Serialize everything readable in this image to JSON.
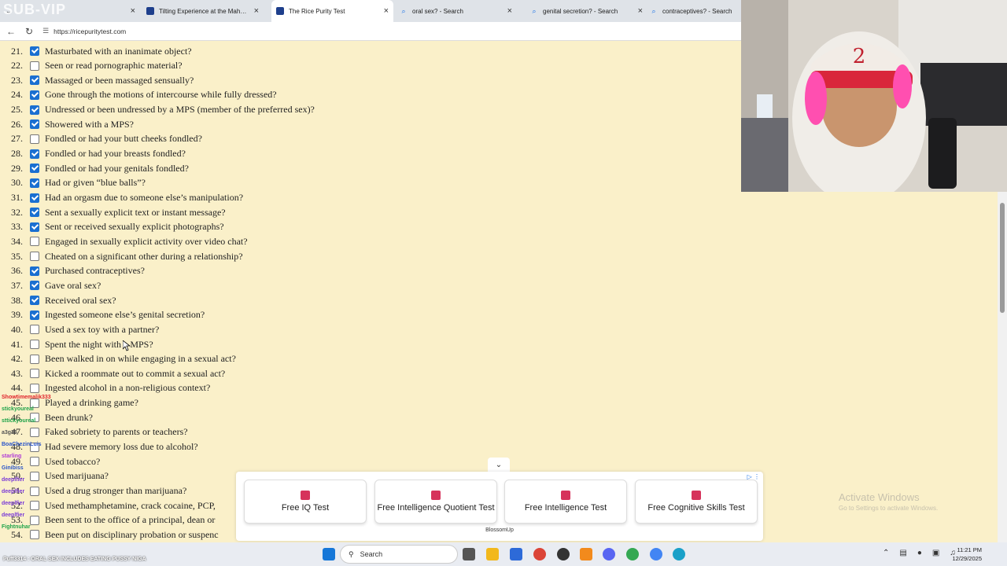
{
  "browser": {
    "tabs": [
      {
        "label": "",
        "icon": "ellipsis"
      },
      {
        "label": "Tilting Experience at the Mahankli",
        "icon": "blue-square"
      },
      {
        "label": "The Rice Purity Test",
        "icon": "blue-square",
        "active": true
      },
      {
        "label": "oral sex? - Search",
        "icon": "search"
      },
      {
        "label": "genital secretion? - Search",
        "icon": "search"
      },
      {
        "label": "contraceptives? - Search",
        "icon": "search"
      }
    ],
    "url": "https://ricepuritytest.com"
  },
  "stream_brand": "SUB-VIP",
  "questions": [
    {
      "num": "21.",
      "text": "Masturbated with an inanimate object?",
      "checked": true
    },
    {
      "num": "22.",
      "text": "Seen or read pornographic material?",
      "checked": false
    },
    {
      "num": "23.",
      "text": "Massaged or been massaged sensually?",
      "checked": true
    },
    {
      "num": "24.",
      "text": "Gone through the motions of intercourse while fully dressed?",
      "checked": true
    },
    {
      "num": "25.",
      "text": "Undressed or been undressed by a MPS (member of the preferred sex)?",
      "checked": true
    },
    {
      "num": "26.",
      "text": "Showered with a MPS?",
      "checked": true
    },
    {
      "num": "27.",
      "text": "Fondled or had your butt cheeks fondled?",
      "checked": false
    },
    {
      "num": "28.",
      "text": "Fondled or had your breasts fondled?",
      "checked": true
    },
    {
      "num": "29.",
      "text": "Fondled or had your genitals fondled?",
      "checked": true
    },
    {
      "num": "30.",
      "text": "Had or given “blue balls”?",
      "checked": true
    },
    {
      "num": "31.",
      "text": "Had an orgasm due to someone else’s manipulation?",
      "checked": true
    },
    {
      "num": "32.",
      "text": "Sent a sexually explicit text or instant message?",
      "checked": true
    },
    {
      "num": "33.",
      "text": "Sent or received sexually explicit photographs?",
      "checked": true
    },
    {
      "num": "34.",
      "text": "Engaged in sexually explicit activity over video chat?",
      "checked": false
    },
    {
      "num": "35.",
      "text": "Cheated on a significant other during a relationship?",
      "checked": false
    },
    {
      "num": "36.",
      "text": "Purchased contraceptives?",
      "checked": true
    },
    {
      "num": "37.",
      "text": "Gave oral sex?",
      "checked": true
    },
    {
      "num": "38.",
      "text": "Received oral sex?",
      "checked": true
    },
    {
      "num": "39.",
      "text": "Ingested someone else’s genital secretion?",
      "checked": true
    },
    {
      "num": "40.",
      "text": "Used a sex toy with a partner?",
      "checked": false
    },
    {
      "num": "41.",
      "text": "Spent the night with a MPS?",
      "checked": false
    },
    {
      "num": "42.",
      "text": "Been walked in on while engaging in a sexual act?",
      "checked": false
    },
    {
      "num": "43.",
      "text": "Kicked a roommate out to commit a sexual act?",
      "checked": false
    },
    {
      "num": "44.",
      "text": "Ingested alcohol in a non-religious context?",
      "checked": false
    },
    {
      "num": "45.",
      "text": "Played a drinking game?",
      "checked": false
    },
    {
      "num": "46.",
      "text": "Been drunk?",
      "checked": false
    },
    {
      "num": "47.",
      "text": "Faked sobriety to parents or teachers?",
      "checked": false
    },
    {
      "num": "48.",
      "text": "Had severe memory loss due to alcohol?",
      "checked": false
    },
    {
      "num": "49.",
      "text": "Used tobacco?",
      "checked": false
    },
    {
      "num": "50.",
      "text": "Used marijuana?",
      "checked": false
    },
    {
      "num": "51.",
      "text": "Used a drug stronger than marijuana?",
      "checked": false
    },
    {
      "num": "52.",
      "text": "Used methamphetamine, crack cocaine, PCP,",
      "checked": false
    },
    {
      "num": "53.",
      "text": "Been sent to the office of a principal, dean or",
      "checked": false
    },
    {
      "num": "54.",
      "text": "Been put on disciplinary probation or suspenc",
      "checked": false
    }
  ],
  "chat": [
    {
      "user": "Showtimemalik333",
      "color": "#e0222a"
    },
    {
      "user": "stickyoureal",
      "color": "#1fa34a"
    },
    {
      "user": "sttickyoureal",
      "color": "#1fa34a"
    },
    {
      "user": "a3g36",
      "color": "#555555"
    },
    {
      "user": "BoaChezinLuis",
      "color": "#2a55c9"
    },
    {
      "user": "starling",
      "color": "#b03ad6"
    },
    {
      "user": "Ginibiss",
      "color": "#2a55c9"
    },
    {
      "user": "deeplfier",
      "color": "#7a3ad6"
    },
    {
      "user": "deeplfier",
      "color": "#7a3ad6"
    },
    {
      "user": "deeplfier",
      "color": "#7a3ad6"
    },
    {
      "user": "deeplfier",
      "color": "#7a3ad6"
    },
    {
      "user": "Fightnuhar",
      "color": "#1fa34a"
    }
  ],
  "ticker": "Puff3314 : ORAL SEX INCLUDES EATING PUSSY NIGA",
  "ad": {
    "cards": [
      {
        "label": "Free IQ Test"
      },
      {
        "label": "Free Intelligence Quotient Test"
      },
      {
        "label": "Free Intelligence Test"
      },
      {
        "label": "Free Cognitive Skills Test"
      }
    ],
    "source": "BlossomUp",
    "collapse_icon": "chevron-down"
  },
  "watermark": {
    "line1": "Activate Windows",
    "line2": "Go to Settings to activate Windows."
  },
  "taskbar": {
    "search_label": "Search",
    "time": "11:21 PM",
    "date": "12/29/2025"
  },
  "colors": {
    "page_bg": "#faf0c9",
    "checkbox_checked": "#1a6fd1",
    "taskbar": "#e9ecf2"
  }
}
